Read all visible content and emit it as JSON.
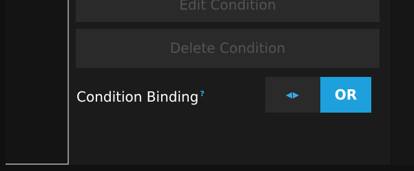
{
  "buttons": {
    "edit_condition": "Edit Condition",
    "delete_condition": "Delete Condition"
  },
  "binding": {
    "label": "Condition Binding",
    "help_mark": "?",
    "toggle_arrows": "◀▶",
    "toggle_value": "OR"
  },
  "colors": {
    "accent": "#1da0dc",
    "button_bg": "#2a2a2a",
    "disabled_text": "#545454"
  }
}
